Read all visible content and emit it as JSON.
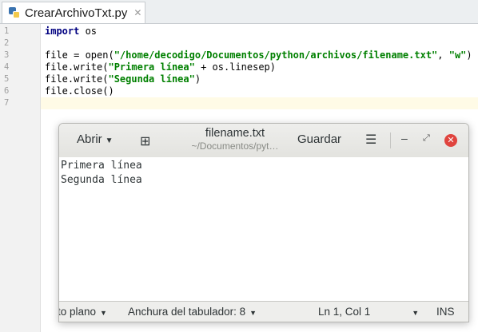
{
  "ide": {
    "tab_label": "CrearArchivoTxt.py",
    "tab_close": "✕",
    "line_numbers": [
      "1",
      "2",
      "3",
      "4",
      "5",
      "6",
      "7"
    ],
    "code": {
      "l1_kw": "import",
      "l1_rest": " os",
      "l3_a": "file = open(",
      "l3_str1": "\"/home/decodigo/Documentos/python/archivos/filename.txt\"",
      "l3_b": ", ",
      "l3_str2": "\"w\"",
      "l3_c": ")",
      "l4_a": "file.write(",
      "l4_str": "\"Primera línea\"",
      "l4_b": " + os.linesep)",
      "l5_a": "file.write(",
      "l5_str": "\"Segunda línea\"",
      "l5_b": ")",
      "l6": "file.close()"
    }
  },
  "gedit": {
    "open_label": "Abrir",
    "open_caret": "▼",
    "new_tab_icon": "⊞",
    "title": "filename.txt",
    "subtitle": "~/Documentos/pyt…",
    "save_label": "Guardar",
    "menu_icon": "☰",
    "minimize_icon": "–",
    "maximize_icon": "⤢",
    "close_icon": "✕",
    "lines": [
      "Primera línea",
      "Segunda línea"
    ],
    "status": {
      "language": "to plano",
      "tab_width": "Anchura del tabulador: 8",
      "position": "Ln 1, Col 1",
      "mode": "INS",
      "caret": "▼"
    }
  },
  "colors": {
    "keyword": "#000080",
    "string": "#008000",
    "close_button": "#e0443e"
  }
}
